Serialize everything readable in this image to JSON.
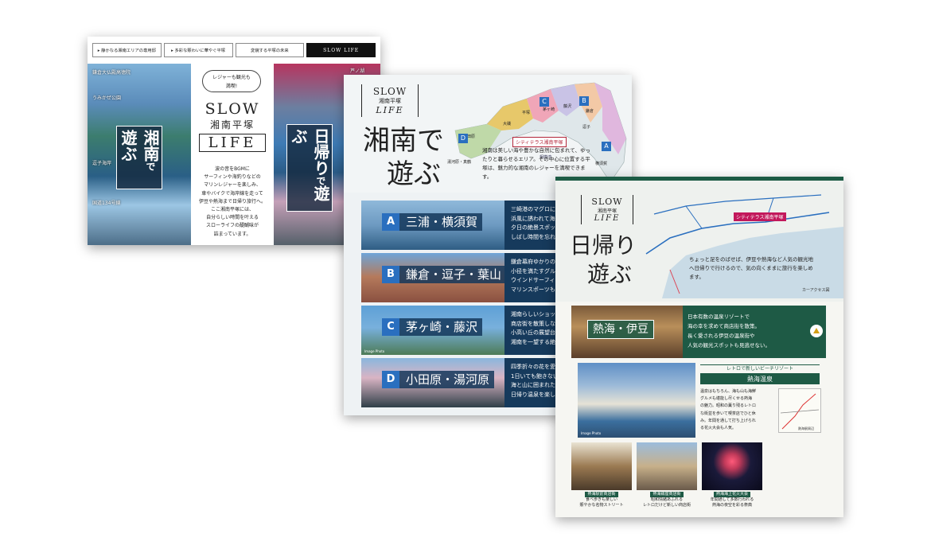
{
  "card1": {
    "nav_tabs": [
      "▸ 静かなる湘南エリアの専用邸",
      "▸ 多彩な賑わいに華やぐ平塚",
      "変貌する平塚の未来",
      "SLOW LIFE"
    ],
    "photo_labels": {
      "daibutsu": "鎌倉大仏殿高徳院",
      "umikaze": "うみかぜ公園",
      "zushi": "逗子海岸",
      "route134": "国道134号線",
      "hakone": "芦ノ湖"
    },
    "overlay_shonan": [
      "湘南",
      "で",
      "遊ぶ"
    ],
    "overlay_higaeri": [
      "日帰り",
      "で",
      "遊ぶ"
    ],
    "badge": [
      "レジャーも観光も",
      "満喫!"
    ],
    "logo": {
      "slow": "SLOW",
      "place": "湘南平塚",
      "life": "LIFE"
    },
    "body_lines": [
      "波の音をBGMに",
      "サーフィンや海釣りなどの",
      "マリンレジャーを楽しみ、",
      "車やバイクで海岸線を走って",
      "伊豆や熱海まで日帰り旅行へ。",
      "ここ湘南平塚には、",
      "自分らしい時間を叶える",
      "スローライフの醍醐味が",
      "詰まっています。"
    ]
  },
  "card2": {
    "logo": {
      "slow": "SLOW",
      "place": "湘南平塚",
      "life": "LIFE"
    },
    "title": [
      "湘南で",
      "遊ぶ"
    ],
    "map_labels": {
      "chigasaki": "茅ヶ崎",
      "hiratsuka": "平塚",
      "fujisawa": "藤沢",
      "kamakura": "鎌倉",
      "oiso": "大磯",
      "odawara": "小田原",
      "yugawara": "湯河原・真鶴",
      "zushi": "逗子",
      "yokosuka": "横須賀",
      "sagamiwan": "相模湾",
      "property": "シティテラス湘南平塚"
    },
    "intro": "湘南は美しい海や豊かな自然に包まれて、ゆったりと暮らせるエリア。その中心に位置する平塚は、魅力的な湘南のレジャーを満喫できます。",
    "segments": [
      {
        "letter": "A",
        "name": "三浦・横須賀",
        "text": [
          "三崎港のマグロに舌",
          "浜風に誘われて海岸",
          "夕日の絶景スポット",
          "しばし時間を忘れて"
        ]
      },
      {
        "letter": "B",
        "name": "鎌倉・逗子・葉山",
        "text": [
          "鎌倉幕府ゆかりの寺",
          "小径を満たすグルメ",
          "ウインドサーフィン",
          "マリンスポーツも楽"
        ]
      },
      {
        "letter": "C",
        "name": "茅ヶ崎・藤沢",
        "text": [
          "湘南らしいショップ",
          "商店街を散策しなが",
          "小高い丘の展望台",
          "湘南を一望する絶景"
        ]
      },
      {
        "letter": "D",
        "name": "小田原・湯河原",
        "text": [
          "四季折々の花を愛で",
          "1日いても飽きない",
          "海と山に囲まれた湯",
          "日帰り温泉を楽しむ"
        ]
      }
    ],
    "image_photo": "Image Photo"
  },
  "card3": {
    "logo": {
      "slow": "SLOW",
      "place": "湘南平塚",
      "life": "LIFE"
    },
    "title": [
      "日帰りで",
      "遊ぶ"
    ],
    "map_property": "シティテラス湘南平塚",
    "map_note": "カーアクセス図",
    "intro": "ちょっと足をのばせば、伊豆や熱海など人気の観光地へ日帰りで行けるので、気の向くままに旅行を楽しめます。",
    "banner": {
      "name": "熱海・伊豆",
      "text": [
        "日本有数の温泉リゾートで",
        "海の幸を求めて商店街を散策。",
        "長く愛される伊豆の温泉街や",
        "人気の観光スポットも見逃せない。"
      ]
    },
    "resort_label": "レトロで新しいビーチリゾート",
    "onsen_title": "熱海温泉",
    "onsen_text": [
      "温泉はもちろん、海も山も海鮮",
      "グルメも堪能し尽くせる熱海",
      "の魅力。昭和の薫り残るレトロ",
      "な街並を歩いて喫茶店でひと休",
      "み。年間を通して打ち上げられ",
      "る花火大会も人気。"
    ],
    "image_photo": "Image Photo",
    "map_guide": "熱海駅周辺",
    "spots": [
      {
        "place": "熱海駅前商店街",
        "desc": [
          "食べ歩きも楽しい",
          "賑やかな名物ストリート"
        ]
      },
      {
        "place": "熱海銀座商店街",
        "desc": [
          "昭和情緒あふれる",
          "レトロだけど新しい商店街"
        ]
      },
      {
        "place": "熱海海上花火大会",
        "desc": [
          "年間通して多数行われる",
          "熱海の夜空を彩る祭典"
        ]
      }
    ],
    "colors": {
      "accent": "#1e5a45",
      "pink": "#c2185b"
    }
  }
}
